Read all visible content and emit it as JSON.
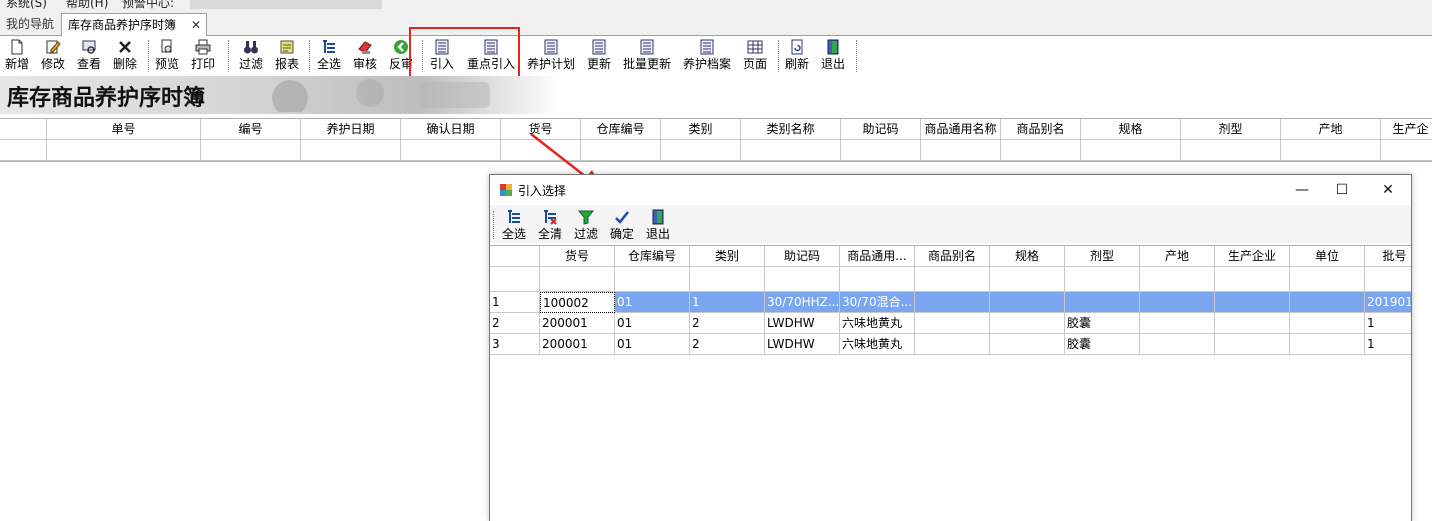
{
  "menubar": {
    "items": [
      "系统(S)",
      "帮助(H)",
      "预警中心:"
    ]
  },
  "tabs": {
    "nav": "我的导航",
    "active": "库存商品养护序时簿",
    "close": "✕"
  },
  "toolbar": {
    "buttons": [
      "新增",
      "修改",
      "查看",
      "删除",
      "预览",
      "打印",
      "过滤",
      "报表",
      "全选",
      "审核",
      "反审",
      "引入",
      "重点引入",
      "养护计划",
      "更新",
      "批量更新",
      "养护档案",
      "页面",
      "刷新",
      "退出"
    ]
  },
  "banner": {
    "title": "库存商品养护序时簿"
  },
  "main_grid": {
    "columns": [
      "单号",
      "编号",
      "养护日期",
      "确认日期",
      "货号",
      "仓库编号",
      "类别",
      "类别名称",
      "助记码",
      "商品通用名称",
      "商品别名",
      "规格",
      "剂型",
      "产地",
      "生产企"
    ]
  },
  "dialog": {
    "title": "引入选择",
    "controls": {
      "minimize": "—",
      "maximize": "☐",
      "close": "✕"
    },
    "tools": [
      "全选",
      "全清",
      "过滤",
      "确定",
      "退出"
    ],
    "columns": [
      "货号",
      "仓库编号",
      "类别",
      "助记码",
      "商品通用...",
      "商品别名",
      "规格",
      "剂型",
      "产地",
      "生产企业",
      "单位",
      "批号"
    ],
    "rows": [
      {
        "n": "1",
        "cells": [
          "100002",
          "01",
          "1",
          "30/70HHZ...",
          "30/70混合...",
          "",
          "",
          "",
          "",
          "",
          "",
          "201901"
        ]
      },
      {
        "n": "2",
        "cells": [
          "200001",
          "01",
          "2",
          "LWDHW",
          "六味地黄丸",
          "",
          "",
          "胶囊",
          "",
          "",
          "",
          "1"
        ]
      },
      {
        "n": "3",
        "cells": [
          "200001",
          "01",
          "2",
          "LWDHW",
          "六味地黄丸",
          "",
          "",
          "胶囊",
          "",
          "",
          "",
          "1"
        ]
      }
    ]
  },
  "colors": {
    "selection": "#7aa6ef",
    "highlight_border": "#e52620",
    "arrow": "#e52620"
  }
}
